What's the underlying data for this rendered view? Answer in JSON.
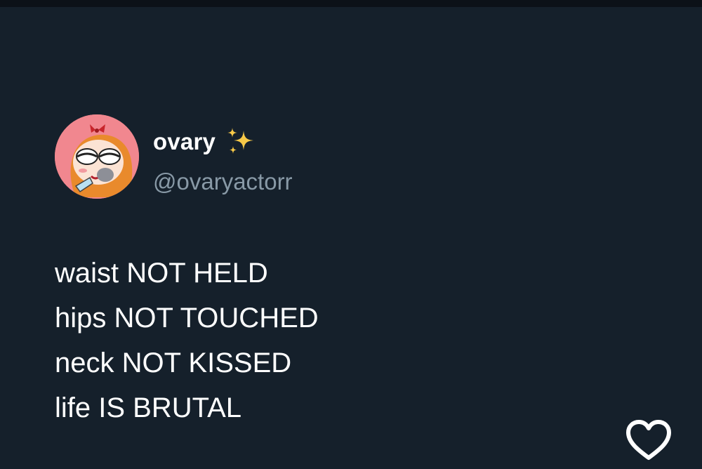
{
  "author": {
    "display_name": "ovary",
    "handle": "@ovaryactorr",
    "name_emoji": "sparkles-icon",
    "avatar": "cartoon-girl-avatar"
  },
  "tweet": {
    "lines": [
      "waist NOT HELD",
      "hips NOT TOUCHED",
      "neck NOT KISSED",
      "life IS BRUTAL"
    ]
  },
  "actions": {
    "like_icon": "heart-icon"
  },
  "colors": {
    "background": "#15202b",
    "top_strip": "#0c1118",
    "text": "#ffffff",
    "handle": "#8899a6",
    "sparkle": "#f7c948",
    "avatar_bg": "#f1878f"
  }
}
